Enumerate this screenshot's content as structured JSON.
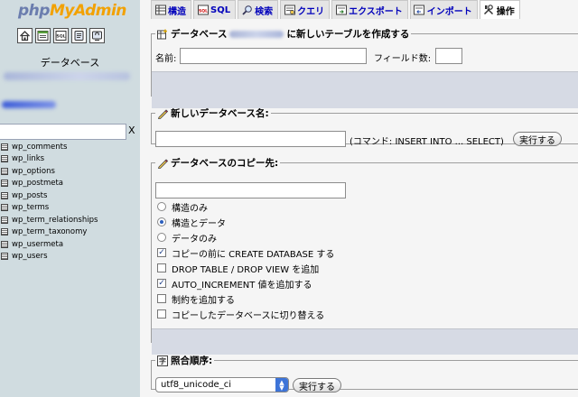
{
  "nav": {
    "logo_php": "php",
    "logo_myadmin": "MyAdmin",
    "icons": [
      "home-icon",
      "query-window-icon",
      "sql-doc-icon",
      "docs-icon",
      "reload-icon"
    ],
    "database_label": "データベース",
    "filter_value": "",
    "filter_clear": "X",
    "tables": [
      "wp_comments",
      "wp_links",
      "wp_options",
      "wp_postmeta",
      "wp_posts",
      "wp_terms",
      "wp_term_relationships",
      "wp_term_taxonomy",
      "wp_usermeta",
      "wp_users"
    ]
  },
  "tabs": [
    {
      "label": "構造",
      "icon": "structure-icon"
    },
    {
      "label": "SQL",
      "icon": "sql-icon"
    },
    {
      "label": "検索",
      "icon": "search-icon"
    },
    {
      "label": "クエリ",
      "icon": "query-icon"
    },
    {
      "label": "エクスポート",
      "icon": "export-icon"
    },
    {
      "label": "インポート",
      "icon": "import-icon"
    },
    {
      "label": "操作",
      "icon": "tools-icon",
      "active": true
    }
  ],
  "create_table": {
    "legend_prefix": "データベース",
    "legend_suffix": "に新しいテーブルを作成する",
    "name_label": "名前:",
    "name_value": "",
    "fields_label": "フィールド数:",
    "fields_value": ""
  },
  "rename_db": {
    "legend": "新しいデータベース名:",
    "input_value": "",
    "hint": "(コマンド: INSERT INTO ... SELECT)",
    "button": "実行する"
  },
  "copy_db": {
    "legend": "データベースのコピー先:",
    "input_value": "",
    "radios": [
      {
        "label": "構造のみ",
        "checked": false
      },
      {
        "label": "構造とデータ",
        "checked": true
      },
      {
        "label": "データのみ",
        "checked": false
      }
    ],
    "checkboxes": [
      {
        "label": "コピーの前に CREATE DATABASE する",
        "checked": true
      },
      {
        "label": "DROP TABLE / DROP VIEW を追加",
        "checked": false
      },
      {
        "label": "AUTO_INCREMENT 値を追加する",
        "checked": true
      },
      {
        "label": "制約を追加する",
        "checked": false
      },
      {
        "label": "コピーしたデータベースに切り替える",
        "checked": false
      }
    ]
  },
  "collation": {
    "legend": "照合順序:",
    "selected": "utf8_unicode_ci",
    "button": "実行する"
  },
  "colors": {
    "nav_bg": "#d0dce0",
    "tab_link": "#0000bb",
    "footer_bar": "#d6dae4",
    "select_arrow": "#3d74d8"
  }
}
